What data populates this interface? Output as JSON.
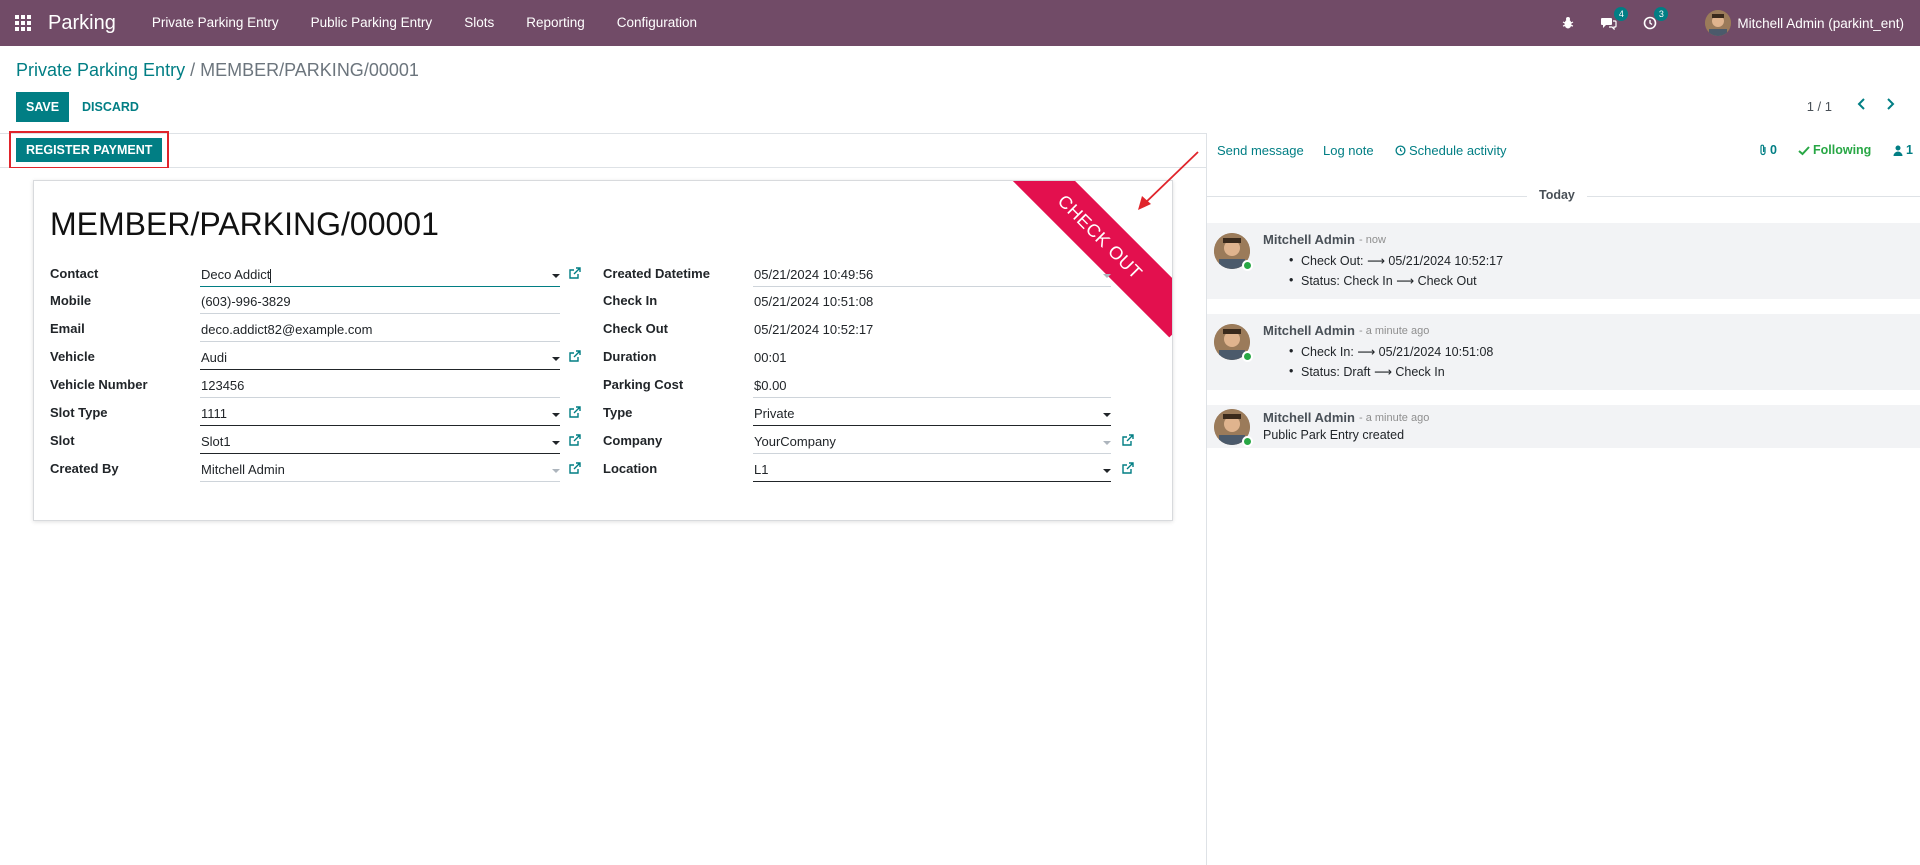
{
  "navbar": {
    "brand": "Parking",
    "menu": [
      "Private Parking Entry",
      "Public Parking Entry",
      "Slots",
      "Reporting",
      "Configuration"
    ],
    "messages_badge": "4",
    "activities_badge": "3",
    "user": "Mitchell Admin (parkint_ent)"
  },
  "breadcrumb": {
    "parent": "Private Parking Entry",
    "separator": "/",
    "current": "MEMBER/PARKING/00001"
  },
  "actions": {
    "save": "SAVE",
    "discard": "DISCARD",
    "register_payment": "REGISTER PAYMENT"
  },
  "pager": {
    "value": "1 / 1",
    "prev": "‹",
    "next": "›"
  },
  "record": {
    "title": "MEMBER/PARKING/00001",
    "ribbon": "CHECK OUT",
    "left_fields": [
      {
        "label": "Contact",
        "value": "Deco Addict"
      },
      {
        "label": "Mobile",
        "value": "(603)-996-3829"
      },
      {
        "label": "Email",
        "value": "deco.addict82@example.com"
      },
      {
        "label": "Vehicle",
        "value": "Audi"
      },
      {
        "label": "Vehicle Number",
        "value": "123456"
      },
      {
        "label": "Slot Type",
        "value": "1111"
      },
      {
        "label": "Slot",
        "value": "Slot1"
      },
      {
        "label": "Created By",
        "value": "Mitchell Admin"
      }
    ],
    "right_fields": [
      {
        "label": "Created Datetime",
        "value": "05/21/2024 10:49:56"
      },
      {
        "label": "Check In",
        "value": "05/21/2024 10:51:08"
      },
      {
        "label": "Check Out",
        "value": "05/21/2024 10:52:17"
      },
      {
        "label": "Duration",
        "value": "00:01"
      },
      {
        "label": "Parking Cost",
        "value": "$0.00"
      },
      {
        "label": "Type",
        "value": "Private"
      },
      {
        "label": "Company",
        "value": "YourCompany"
      },
      {
        "label": "Location",
        "value": "L1"
      }
    ]
  },
  "chatter": {
    "send_message": "Send message",
    "log_note": "Log note",
    "schedule_activity": "Schedule activity",
    "attachments": "0",
    "following": "Following",
    "followers": "1",
    "today": "Today",
    "messages": [
      {
        "author": "Mitchell Admin",
        "date": "- now",
        "lines": [
          "Check Out: ⟶ 05/21/2024 10:52:17",
          "Status: Check In ⟶ Check Out"
        ]
      },
      {
        "author": "Mitchell Admin",
        "date": "- a minute ago",
        "lines": [
          "Check In: ⟶ 05/21/2024 10:51:08",
          "Status: Draft ⟶ Check In"
        ]
      },
      {
        "author": "Mitchell Admin",
        "date": "- a minute ago",
        "body": "Public Park Entry created"
      }
    ]
  },
  "colors": {
    "navbar": "#714b67",
    "primary": "#017e84",
    "ribbon": "#e3104e",
    "annotation": "#e0242b",
    "following": "#28a745"
  }
}
